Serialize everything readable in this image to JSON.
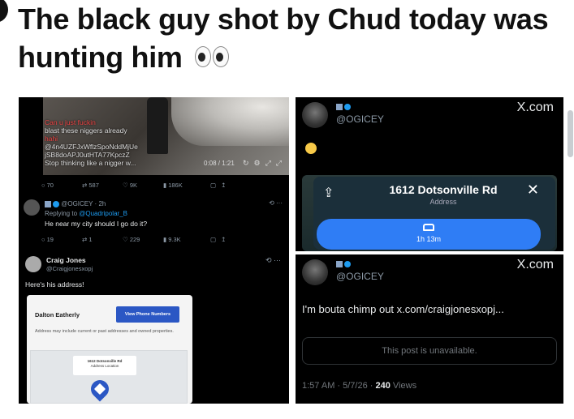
{
  "headline": {
    "text": "The black guy shot by Chud today was hunting him",
    "emoji": "eyes-emoji"
  },
  "left_top": {
    "overlay_lines": [
      "Can u just fuckin",
      "blast these niggers already",
      "hahi",
      "@4n4UZFJxWflzSpoNddMjUe",
      "jSB8doAPJ0utHTA77KpczZ",
      "Stop thinking like a nigger w..."
    ],
    "video_time": "0:08 / 1:21",
    "stats": {
      "replies": "70",
      "reposts": "587",
      "likes": "9K",
      "views": "186K"
    },
    "reply": {
      "handle": "@OGICEY · 2h",
      "replying_to_prefix": "Replying to",
      "replying_to": "@Quadripolar_B",
      "text": "He near my city should I go do it?",
      "stats": {
        "replies": "19",
        "reposts": "1",
        "likes": "229",
        "views": "9.3K"
      }
    }
  },
  "left_bottom": {
    "name": "Craig Jones",
    "handle": "@Craigjonesxopj",
    "text": "Here's his address!",
    "card": {
      "person": "Dalton Eatherly",
      "button": "View Phone Numbers",
      "note": "Address may include current or past addresses and owned properties.",
      "map_title": "1612 Dotsonville Rd",
      "map_sub": "Address Location"
    }
  },
  "right_top": {
    "handle": "@OGICEY",
    "source": "X.com",
    "destination": "1612 Dotsonville Rd",
    "destination_type": "Address",
    "route_time": "1h 13m"
  },
  "right_bottom": {
    "handle": "@OGICEY",
    "source": "X.com",
    "text": "I'm bouta chimp out x.com/craigjonesxopj...",
    "unavailable": "This post is unavailable.",
    "time": "1:57 AM · 5/7/26 · ",
    "views_count": "240",
    "views_label": "Views"
  }
}
